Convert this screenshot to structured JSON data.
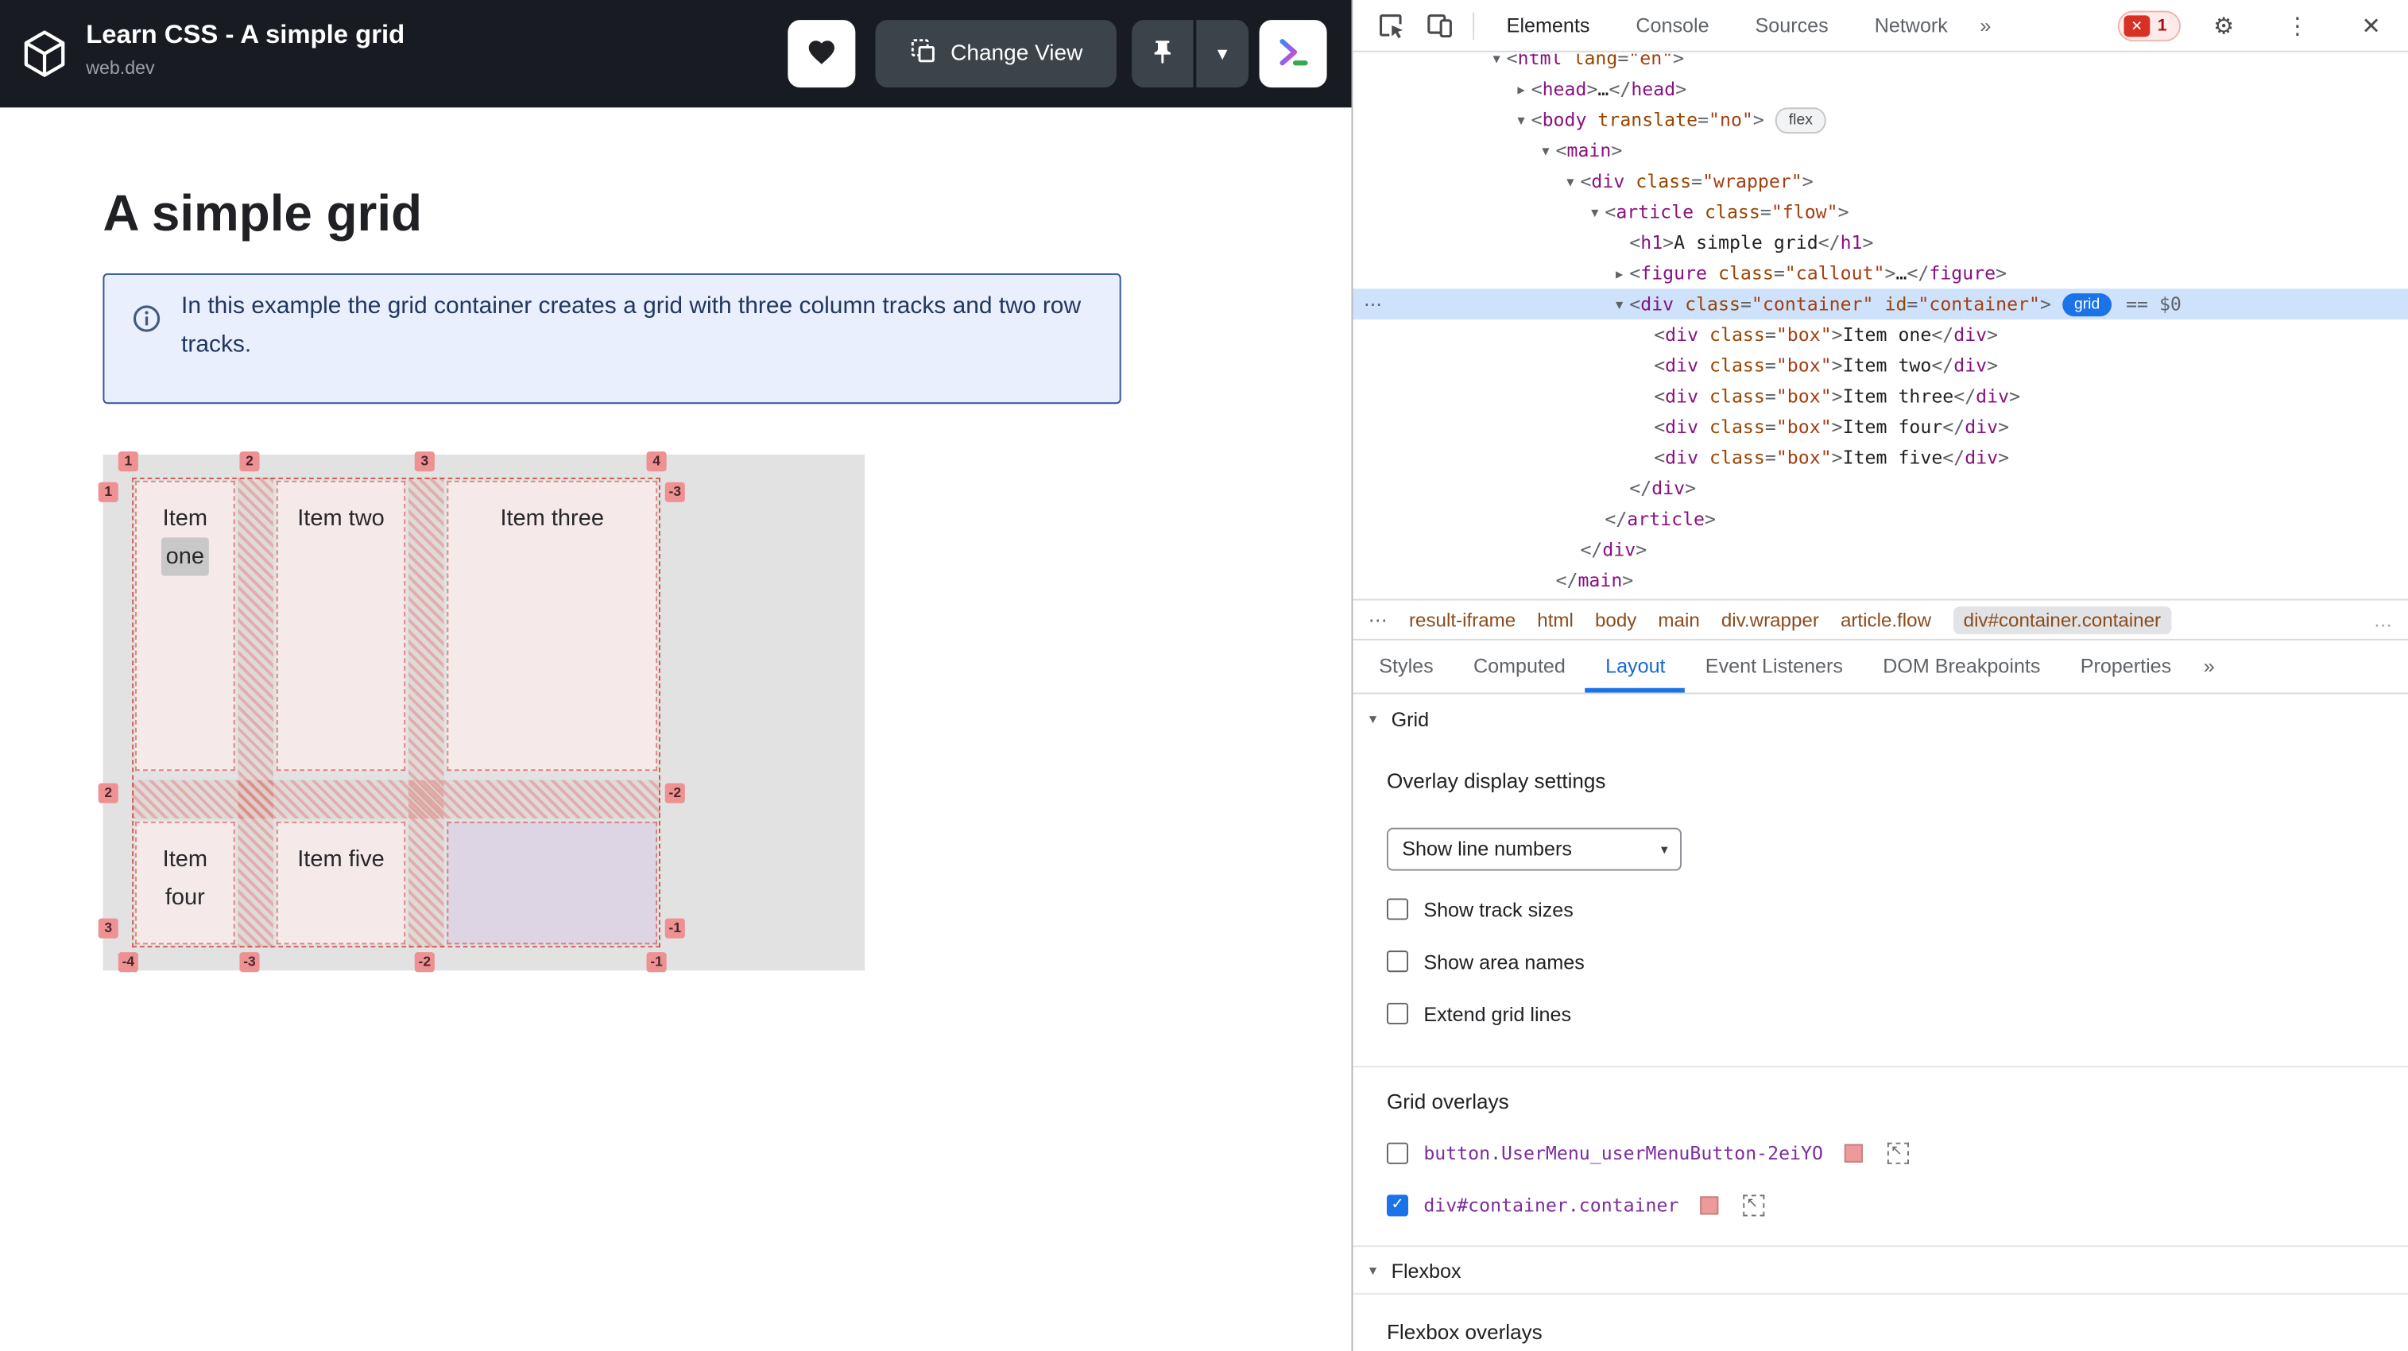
{
  "header": {
    "title": "Learn CSS - A simple grid",
    "site": "web.dev",
    "change_view": "Change View"
  },
  "article": {
    "heading": "A simple grid",
    "callout": "In this example the grid container creates a grid with three column tracks and two row tracks."
  },
  "grid_demo": {
    "items": [
      {
        "line1": "Item",
        "line2": "one",
        "hl": true
      },
      {
        "line1": "Item two",
        "line2": ""
      },
      {
        "line1": "Item three",
        "line2": ""
      },
      {
        "line1": "Item",
        "line2": "four"
      },
      {
        "line1": "Item five",
        "line2": ""
      }
    ],
    "badges_top": [
      "1",
      "2",
      "3",
      "4"
    ],
    "badges_bottom": [
      "-4",
      "-3",
      "-2",
      "-1"
    ],
    "badges_left": [
      "1",
      "2",
      "3"
    ],
    "badges_right": [
      "-3",
      "-2",
      "-1"
    ]
  },
  "devtools": {
    "tabs": [
      {
        "label": "Elements",
        "active": true
      },
      {
        "label": "Console"
      },
      {
        "label": "Sources"
      },
      {
        "label": "Network"
      }
    ],
    "error_count": "1",
    "tree": [
      {
        "indent": 0,
        "arrow": "down",
        "tokens": [
          [
            "p",
            "<"
          ],
          [
            "t",
            "html"
          ],
          [
            "a",
            " lang"
          ],
          [
            "p",
            "="
          ],
          [
            "v",
            "\"en\""
          ],
          [
            "p",
            ">"
          ]
        ]
      },
      {
        "indent": 1,
        "arrow": "right",
        "tokens": [
          [
            "p",
            "<"
          ],
          [
            "t",
            "head"
          ],
          [
            "p",
            ">"
          ],
          [
            "x",
            "…"
          ],
          [
            "p",
            "</"
          ],
          [
            "t",
            "head"
          ],
          [
            "p",
            ">"
          ]
        ]
      },
      {
        "indent": 1,
        "arrow": "down",
        "tokens": [
          [
            "p",
            "<"
          ],
          [
            "t",
            "body"
          ],
          [
            "a",
            " translate"
          ],
          [
            "p",
            "="
          ],
          [
            "v",
            "\"no\""
          ],
          [
            "p",
            ">"
          ]
        ],
        "badge": "flex"
      },
      {
        "indent": 2,
        "arrow": "down",
        "tokens": [
          [
            "p",
            "<"
          ],
          [
            "t",
            "main"
          ],
          [
            "p",
            ">"
          ]
        ]
      },
      {
        "indent": 3,
        "arrow": "down",
        "tokens": [
          [
            "p",
            "<"
          ],
          [
            "t",
            "div"
          ],
          [
            "a",
            " class"
          ],
          [
            "p",
            "="
          ],
          [
            "v",
            "\"wrapper\""
          ],
          [
            "p",
            ">"
          ]
        ]
      },
      {
        "indent": 4,
        "arrow": "down",
        "tokens": [
          [
            "p",
            "<"
          ],
          [
            "t",
            "article"
          ],
          [
            "a",
            " class"
          ],
          [
            "p",
            "="
          ],
          [
            "v",
            "\"flow\""
          ],
          [
            "p",
            ">"
          ]
        ]
      },
      {
        "indent": 5,
        "arrow": "none",
        "tokens": [
          [
            "p",
            "<"
          ],
          [
            "t",
            "h1"
          ],
          [
            "p",
            ">"
          ],
          [
            "x",
            "A simple grid"
          ],
          [
            "p",
            "</"
          ],
          [
            "t",
            "h1"
          ],
          [
            "p",
            ">"
          ]
        ]
      },
      {
        "indent": 5,
        "arrow": "right",
        "tokens": [
          [
            "p",
            "<"
          ],
          [
            "t",
            "figure"
          ],
          [
            "a",
            " class"
          ],
          [
            "p",
            "="
          ],
          [
            "v",
            "\"callout\""
          ],
          [
            "p",
            ">"
          ],
          [
            "x",
            "…"
          ],
          [
            "p",
            "</"
          ],
          [
            "t",
            "figure"
          ],
          [
            "p",
            ">"
          ]
        ]
      },
      {
        "indent": 5,
        "arrow": "down",
        "selected": true,
        "badge": "grid",
        "suffix": "== $0",
        "tokens": [
          [
            "p",
            "<"
          ],
          [
            "t",
            "div"
          ],
          [
            "a",
            " class"
          ],
          [
            "p",
            "="
          ],
          [
            "v",
            "\"container\""
          ],
          [
            "a",
            " id"
          ],
          [
            "p",
            "="
          ],
          [
            "v",
            "\"container\""
          ],
          [
            "p",
            ">"
          ]
        ]
      },
      {
        "indent": 6,
        "arrow": "none",
        "tokens": [
          [
            "p",
            "<"
          ],
          [
            "t",
            "div"
          ],
          [
            "a",
            " class"
          ],
          [
            "p",
            "="
          ],
          [
            "v",
            "\"box\""
          ],
          [
            "p",
            ">"
          ],
          [
            "x",
            "Item one"
          ],
          [
            "p",
            "</"
          ],
          [
            "t",
            "div"
          ],
          [
            "p",
            ">"
          ]
        ]
      },
      {
        "indent": 6,
        "arrow": "none",
        "tokens": [
          [
            "p",
            "<"
          ],
          [
            "t",
            "div"
          ],
          [
            "a",
            " class"
          ],
          [
            "p",
            "="
          ],
          [
            "v",
            "\"box\""
          ],
          [
            "p",
            ">"
          ],
          [
            "x",
            "Item two"
          ],
          [
            "p",
            "</"
          ],
          [
            "t",
            "div"
          ],
          [
            "p",
            ">"
          ]
        ]
      },
      {
        "indent": 6,
        "arrow": "none",
        "tokens": [
          [
            "p",
            "<"
          ],
          [
            "t",
            "div"
          ],
          [
            "a",
            " class"
          ],
          [
            "p",
            "="
          ],
          [
            "v",
            "\"box\""
          ],
          [
            "p",
            ">"
          ],
          [
            "x",
            "Item three"
          ],
          [
            "p",
            "</"
          ],
          [
            "t",
            "div"
          ],
          [
            "p",
            ">"
          ]
        ]
      },
      {
        "indent": 6,
        "arrow": "none",
        "tokens": [
          [
            "p",
            "<"
          ],
          [
            "t",
            "div"
          ],
          [
            "a",
            " class"
          ],
          [
            "p",
            "="
          ],
          [
            "v",
            "\"box\""
          ],
          [
            "p",
            ">"
          ],
          [
            "x",
            "Item four"
          ],
          [
            "p",
            "</"
          ],
          [
            "t",
            "div"
          ],
          [
            "p",
            ">"
          ]
        ]
      },
      {
        "indent": 6,
        "arrow": "none",
        "tokens": [
          [
            "p",
            "<"
          ],
          [
            "t",
            "div"
          ],
          [
            "a",
            " class"
          ],
          [
            "p",
            "="
          ],
          [
            "v",
            "\"box\""
          ],
          [
            "p",
            ">"
          ],
          [
            "x",
            "Item five"
          ],
          [
            "p",
            "</"
          ],
          [
            "t",
            "div"
          ],
          [
            "p",
            ">"
          ]
        ]
      },
      {
        "indent": 5,
        "arrow": "none",
        "tokens": [
          [
            "p",
            "</"
          ],
          [
            "t",
            "div"
          ],
          [
            "p",
            ">"
          ]
        ]
      },
      {
        "indent": 4,
        "arrow": "none",
        "tokens": [
          [
            "p",
            "</"
          ],
          [
            "t",
            "article"
          ],
          [
            "p",
            ">"
          ]
        ]
      },
      {
        "indent": 3,
        "arrow": "none",
        "tokens": [
          [
            "p",
            "</"
          ],
          [
            "t",
            "div"
          ],
          [
            "p",
            ">"
          ]
        ]
      },
      {
        "indent": 2,
        "arrow": "none",
        "tokens": [
          [
            "p",
            "</"
          ],
          [
            "t",
            "main"
          ],
          [
            "p",
            ">"
          ]
        ]
      }
    ],
    "breadcrumbs": [
      {
        "label": "⋯",
        "ellipsis": true
      },
      {
        "label": "result-iframe"
      },
      {
        "label": "html"
      },
      {
        "label": "body"
      },
      {
        "label": "main"
      },
      {
        "label": "div.wrapper"
      },
      {
        "label": "article.flow"
      },
      {
        "label": "div#container.container",
        "active": true
      }
    ],
    "crumb_more": "…",
    "panel_tabs": [
      {
        "label": "Styles"
      },
      {
        "label": "Computed"
      },
      {
        "label": "Layout",
        "active": true
      },
      {
        "label": "Event Listeners"
      },
      {
        "label": "DOM Breakpoints"
      },
      {
        "label": "Properties"
      }
    ],
    "layout": {
      "grid_header": "Grid",
      "overlay_settings": "Overlay display settings",
      "dropdown_value": "Show line numbers",
      "settings": [
        {
          "label": "Show track sizes",
          "checked": false
        },
        {
          "label": "Show area names",
          "checked": false
        },
        {
          "label": "Extend grid lines",
          "checked": false
        }
      ],
      "grid_overlays_header": "Grid overlays",
      "overlays": [
        {
          "label": "button.UserMenu_userMenuButton-2eiYO",
          "checked": false
        },
        {
          "label": "div#container.container",
          "checked": true
        }
      ],
      "flexbox_header": "Flexbox",
      "flexbox_overlays_header": "Flexbox overlays"
    }
  },
  "glyphs": {
    "chevron_down": "▾",
    "double_chevron": "»",
    "ellipsis_h": "⋯",
    "ellipsis": "…",
    "dots_v": "⋮",
    "close": "✕",
    "gear": "⚙",
    "tri_down": "▼",
    "tri_right": "▶",
    "check": "✓",
    "select_caret": "▾",
    "arrow_nw": "↖"
  }
}
